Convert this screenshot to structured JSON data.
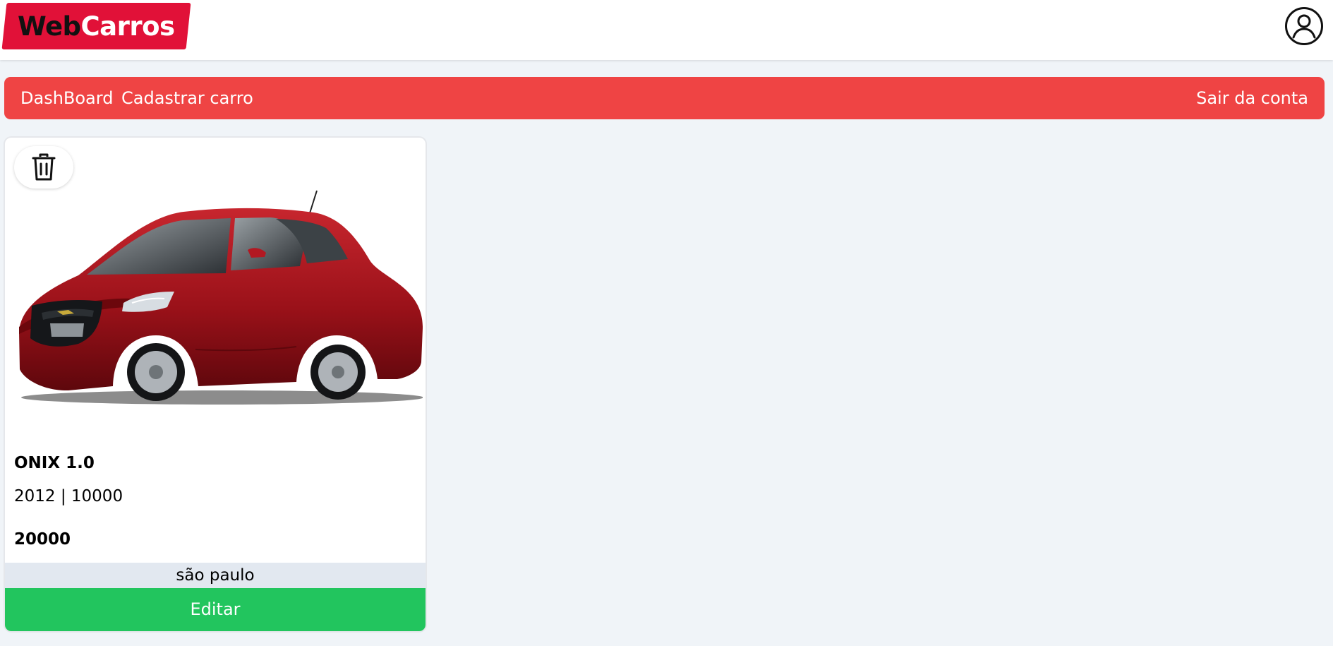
{
  "header": {
    "logo": {
      "part1": "Web",
      "part2": "Carros"
    },
    "user_icon": "user-circle-icon"
  },
  "nav": {
    "dashboard": "DashBoard",
    "new_car": "Cadastrar carro",
    "logout": "Sair da conta"
  },
  "cars": [
    {
      "name": "ONIX 1.0",
      "year_km": "2012 | 10000",
      "price": "20000",
      "city": "são paulo",
      "edit_label": "Editar",
      "delete_icon": "trash-icon",
      "image": "car-photo"
    }
  ],
  "colors": {
    "brand": "#e11138",
    "navbar": "#ef4444",
    "edit": "#22c55e",
    "city_bg": "#e2e8f0",
    "page_bg": "#f0f4f8"
  }
}
